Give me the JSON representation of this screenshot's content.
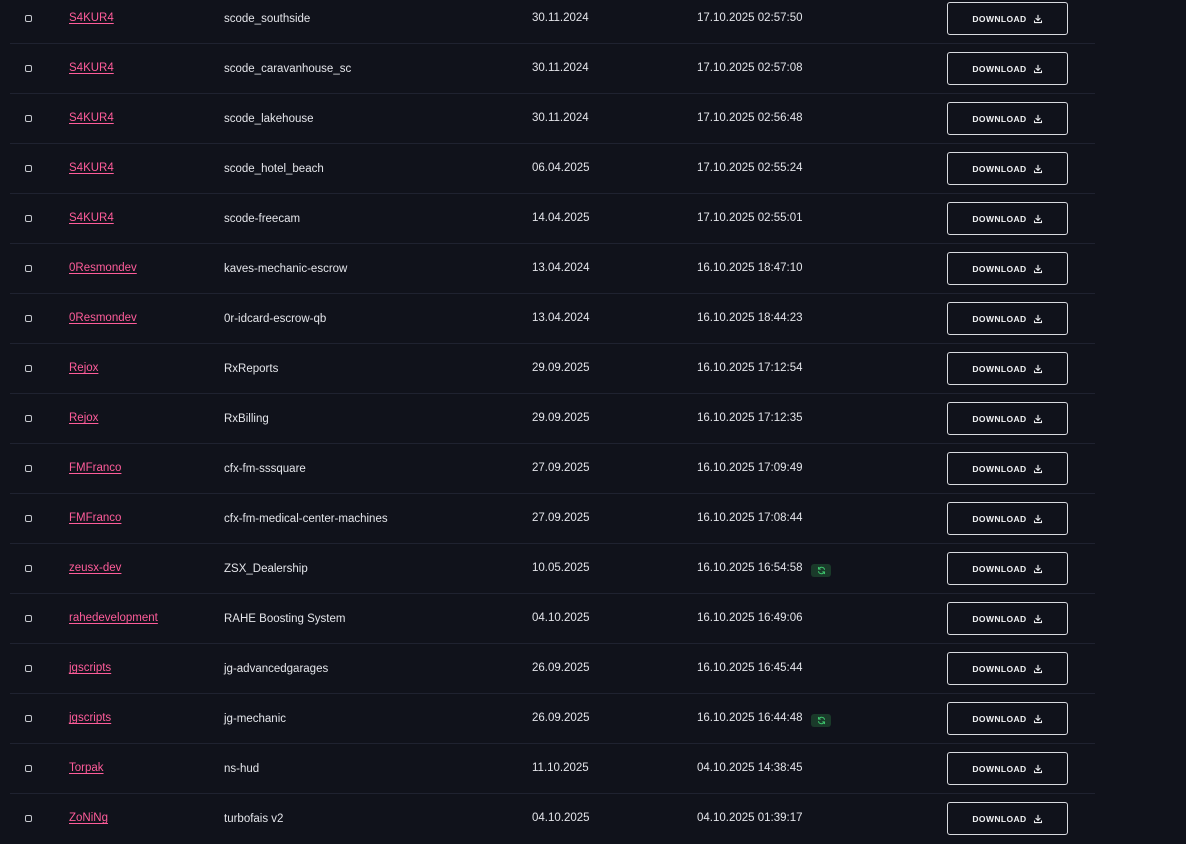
{
  "download_label": "DOWNLOAD",
  "icons": {
    "download": "download-icon",
    "refresh": "refresh-icon",
    "checkbox": "checkbox"
  },
  "colors": {
    "accent_link": "#ff5c9a",
    "badge_bg": "#1a3a2a",
    "badge_icon": "#3ec46d",
    "background": "#10121b"
  },
  "rows": [
    {
      "author": "S4KUR4",
      "name": "scode_southside",
      "created": "30.11.2024",
      "updated": "17.10.2025 02:57:50",
      "badge": false
    },
    {
      "author": "S4KUR4",
      "name": "scode_caravanhouse_sc",
      "created": "30.11.2024",
      "updated": "17.10.2025 02:57:08",
      "badge": false
    },
    {
      "author": "S4KUR4",
      "name": "scode_lakehouse",
      "created": "30.11.2024",
      "updated": "17.10.2025 02:56:48",
      "badge": false
    },
    {
      "author": "S4KUR4",
      "name": "scode_hotel_beach",
      "created": "06.04.2025",
      "updated": "17.10.2025 02:55:24",
      "badge": false
    },
    {
      "author": "S4KUR4",
      "name": "scode-freecam",
      "created": "14.04.2025",
      "updated": "17.10.2025 02:55:01",
      "badge": false
    },
    {
      "author": "0Resmondev",
      "name": "kaves-mechanic-escrow",
      "created": "13.04.2024",
      "updated": "16.10.2025 18:47:10",
      "badge": false
    },
    {
      "author": "0Resmondev",
      "name": "0r-idcard-escrow-qb",
      "created": "13.04.2024",
      "updated": "16.10.2025 18:44:23",
      "badge": false
    },
    {
      "author": "Rejox",
      "name": "RxReports",
      "created": "29.09.2025",
      "updated": "16.10.2025 17:12:54",
      "badge": false
    },
    {
      "author": "Rejox",
      "name": "RxBilling",
      "created": "29.09.2025",
      "updated": "16.10.2025 17:12:35",
      "badge": false
    },
    {
      "author": "FMFranco",
      "name": "cfx-fm-sssquare",
      "created": "27.09.2025",
      "updated": "16.10.2025 17:09:49",
      "badge": false
    },
    {
      "author": "FMFranco",
      "name": "cfx-fm-medical-center-machines",
      "created": "27.09.2025",
      "updated": "16.10.2025 17:08:44",
      "badge": false
    },
    {
      "author": "zeusx-dev",
      "name": "ZSX_Dealership",
      "created": "10.05.2025",
      "updated": "16.10.2025 16:54:58",
      "badge": true
    },
    {
      "author": "rahedevelopment",
      "name": "RAHE Boosting System",
      "created": "04.10.2025",
      "updated": "16.10.2025 16:49:06",
      "badge": false
    },
    {
      "author": "jgscripts",
      "name": "jg-advancedgarages",
      "created": "26.09.2025",
      "updated": "16.10.2025 16:45:44",
      "badge": false
    },
    {
      "author": "jgscripts",
      "name": "jg-mechanic",
      "created": "26.09.2025",
      "updated": "16.10.2025 16:44:48",
      "badge": true
    },
    {
      "author": "Torpak",
      "name": "ns-hud",
      "created": "11.10.2025",
      "updated": "04.10.2025 14:38:45",
      "badge": false
    },
    {
      "author": "ZoNiNg",
      "name": "turbofais v2",
      "created": "04.10.2025",
      "updated": "04.10.2025 01:39:17",
      "badge": false
    }
  ]
}
